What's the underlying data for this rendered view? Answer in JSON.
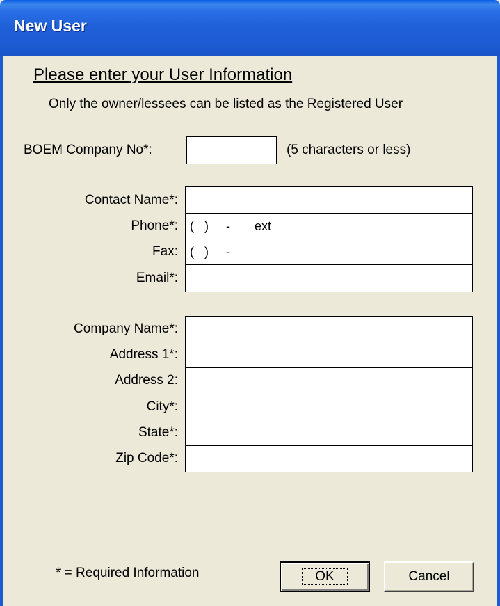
{
  "window": {
    "title": "New User"
  },
  "header": {
    "heading": "Please enter your User Information",
    "subheading": "Only the owner/lessees can be listed as the Registered User"
  },
  "company_no": {
    "label": "BOEM Company No*:",
    "value": "",
    "hint": "(5 characters or less)"
  },
  "contact": {
    "name_label": "Contact Name*:",
    "name_value": "",
    "phone_label": "Phone*:",
    "phone_value": "(   )     -       ext",
    "fax_label": "Fax:",
    "fax_value": "(   )     -",
    "email_label": "Email*:",
    "email_value": ""
  },
  "company": {
    "name_label": "Company Name*:",
    "name_value": "",
    "address1_label": "Address 1*:",
    "address1_value": "",
    "address2_label": "Address 2:",
    "address2_value": "",
    "city_label": "City*:",
    "city_value": "",
    "state_label": "State*:",
    "state_value": "",
    "zip_label": "Zip Code*:",
    "zip_value": ""
  },
  "footer": {
    "required_note": "* = Required Information",
    "ok_label": "OK",
    "cancel_label": "Cancel"
  },
  "colors": {
    "titlebar": "#1d5bd3",
    "dialog_bg": "#ece9d8",
    "field_bg": "#ffffff"
  }
}
